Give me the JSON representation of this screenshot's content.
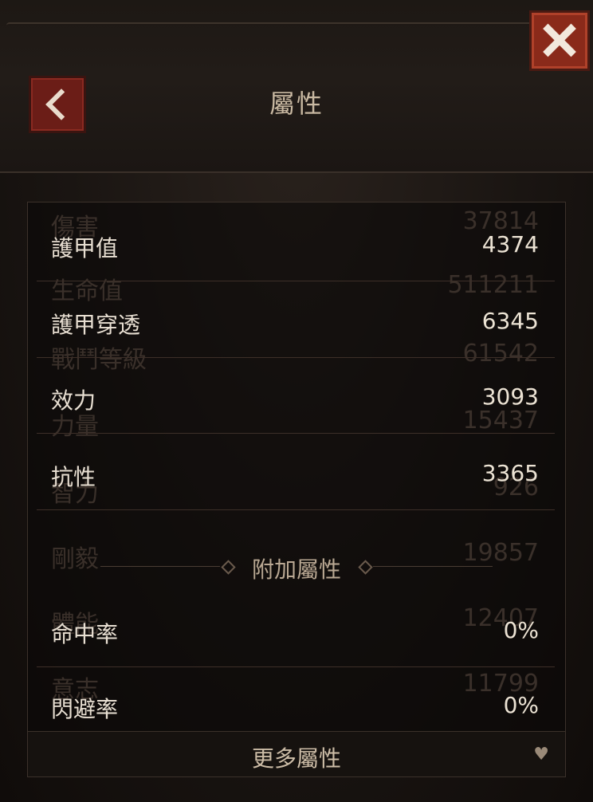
{
  "header": {
    "title": "屬性"
  },
  "icons": {
    "back": "back-chevron-icon",
    "close": "close-x-icon",
    "more": "heart-arrow-icon"
  },
  "ghost_stats": [
    {
      "label": "傷害",
      "value": "37814"
    },
    {
      "label": "生命值",
      "value": "511211"
    },
    {
      "label": "戰鬥等級",
      "value": "61542"
    },
    {
      "label": "力量",
      "value": "15437"
    },
    {
      "label": "智力",
      "value": "926"
    },
    {
      "label": "剛毅",
      "value": "19857"
    },
    {
      "label": "體能",
      "value": "12407"
    },
    {
      "label": "意志",
      "value": "11799"
    }
  ],
  "stats": [
    {
      "label": "護甲值",
      "value": "4374"
    },
    {
      "label": "護甲穿透",
      "value": "6345"
    },
    {
      "label": "效力",
      "value": "3093"
    },
    {
      "label": "抗性",
      "value": "3365"
    }
  ],
  "additional": {
    "title": "附加屬性",
    "stats": [
      {
        "label": "命中率",
        "value": "0%"
      },
      {
        "label": "閃避率",
        "value": "0%"
      }
    ]
  },
  "more_label": "更多屬性",
  "colors": {
    "accent": "#8a2a1a",
    "text": "#e8dfd2",
    "muted": "#b9a893"
  }
}
